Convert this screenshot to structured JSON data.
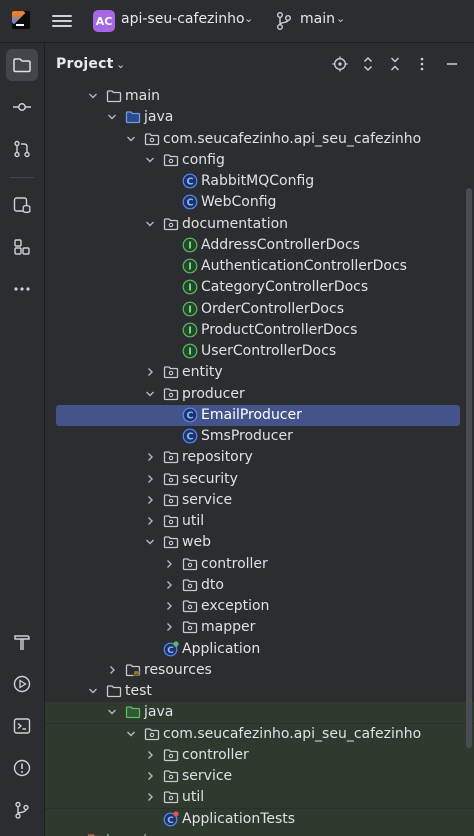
{
  "topbar": {
    "project_badge": "AC",
    "project_name": "api-seu-cafezinho",
    "branch_name": "main"
  },
  "sidebar": {
    "items": [
      {
        "name": "project-tool",
        "icon": "folder-icon",
        "active": true
      },
      {
        "name": "commit-tool",
        "icon": "commit-icon",
        "active": false
      },
      {
        "name": "pull-requests-tool",
        "icon": "pull-request-icon",
        "active": false
      },
      {
        "name": "services-tool",
        "icon": "database-icon",
        "active": false
      },
      {
        "name": "structure-tool",
        "icon": "structure-icon",
        "active": false
      },
      {
        "name": "more-tools",
        "icon": "more-icon",
        "active": false
      },
      {
        "name": "build-tool",
        "icon": "hammer-icon",
        "active": false
      },
      {
        "name": "run-tool",
        "icon": "run-icon",
        "active": false
      },
      {
        "name": "terminal-tool",
        "icon": "terminal-icon",
        "active": false
      },
      {
        "name": "problems-tool",
        "icon": "problems-icon",
        "active": false
      },
      {
        "name": "git-tool",
        "icon": "git-icon",
        "active": false
      }
    ]
  },
  "panel": {
    "title": "Project",
    "header_icons": [
      "locate-icon",
      "expand-icon",
      "collapse-icon",
      "more-vertical-icon",
      "minimize-icon"
    ]
  },
  "tree": [
    {
      "label": "main",
      "level": 3,
      "type": "folder",
      "expanded": true
    },
    {
      "label": "java",
      "level": 4,
      "type": "source-folder",
      "expanded": true
    },
    {
      "label": "com.seucafezinho.api_seu_cafezinho",
      "level": 5,
      "type": "package",
      "expanded": true
    },
    {
      "label": "config",
      "level": 6,
      "type": "package",
      "expanded": true
    },
    {
      "label": "RabbitMQConfig",
      "level": 7,
      "type": "class"
    },
    {
      "label": "WebConfig",
      "level": 7,
      "type": "class"
    },
    {
      "label": "documentation",
      "level": 6,
      "type": "package",
      "expanded": true
    },
    {
      "label": "AddressControllerDocs",
      "level": 7,
      "type": "interface"
    },
    {
      "label": "AuthenticationControllerDocs",
      "level": 7,
      "type": "interface"
    },
    {
      "label": "CategoryControllerDocs",
      "level": 7,
      "type": "interface"
    },
    {
      "label": "OrderControllerDocs",
      "level": 7,
      "type": "interface"
    },
    {
      "label": "ProductControllerDocs",
      "level": 7,
      "type": "interface"
    },
    {
      "label": "UserControllerDocs",
      "level": 7,
      "type": "interface"
    },
    {
      "label": "entity",
      "level": 6,
      "type": "package",
      "expanded": false
    },
    {
      "label": "producer",
      "level": 6,
      "type": "package",
      "expanded": true
    },
    {
      "label": "EmailProducer",
      "level": 7,
      "type": "class",
      "selected": true
    },
    {
      "label": "SmsProducer",
      "level": 7,
      "type": "class"
    },
    {
      "label": "repository",
      "level": 6,
      "type": "package",
      "expanded": false
    },
    {
      "label": "security",
      "level": 6,
      "type": "package",
      "expanded": false
    },
    {
      "label": "service",
      "level": 6,
      "type": "package",
      "expanded": false
    },
    {
      "label": "util",
      "level": 6,
      "type": "package",
      "expanded": false
    },
    {
      "label": "web",
      "level": 6,
      "type": "package",
      "expanded": true
    },
    {
      "label": "controller",
      "level": 7,
      "type": "package",
      "expanded": false
    },
    {
      "label": "dto",
      "level": 7,
      "type": "package",
      "expanded": false
    },
    {
      "label": "exception",
      "level": 7,
      "type": "package",
      "expanded": false
    },
    {
      "label": "mapper",
      "level": 7,
      "type": "package",
      "expanded": false
    },
    {
      "label": "Application",
      "level": 6,
      "type": "spring-app"
    },
    {
      "label": "resources",
      "level": 4,
      "type": "resources-folder",
      "expanded": false
    },
    {
      "label": "test",
      "level": 3,
      "type": "folder",
      "expanded": true
    },
    {
      "label": "java",
      "level": 4,
      "type": "test-source-folder",
      "expanded": true,
      "test": true
    },
    {
      "label": "com.seucafezinho.api_seu_cafezinho",
      "level": 5,
      "type": "package",
      "expanded": true,
      "test": true
    },
    {
      "label": "controller",
      "level": 6,
      "type": "package",
      "expanded": false,
      "test": true
    },
    {
      "label": "service",
      "level": 6,
      "type": "package",
      "expanded": false,
      "test": true
    },
    {
      "label": "util",
      "level": 6,
      "type": "package",
      "expanded": false,
      "test": true
    },
    {
      "label": "ApplicationTests",
      "level": 6,
      "type": "spring-test",
      "test": true
    },
    {
      "label": "target",
      "level": 2,
      "type": "excluded-folder",
      "expanded": false,
      "test": true
    }
  ],
  "colors": {
    "background": "#2b2d30",
    "selection": "#43548a",
    "test_area": "#2f3a2f",
    "class_icon": "#548af7",
    "interface_icon": "#5fb865",
    "badge": "#a567e4"
  }
}
